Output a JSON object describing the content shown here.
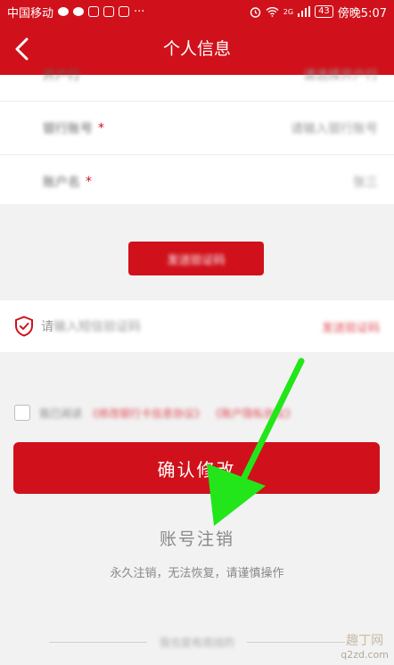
{
  "status_bar": {
    "carrier": "中国移动",
    "more": "···",
    "network": "2G",
    "battery": "43",
    "time": "傍晚5:07"
  },
  "header": {
    "title": "个人信息"
  },
  "form": {
    "partial_label": "开户行",
    "partial_value": "请选择开户行",
    "rows": [
      {
        "label": "银行账号",
        "required": "*",
        "value": "请输入银行账号"
      },
      {
        "label": "账户名",
        "required": "*",
        "value": "张三"
      }
    ]
  },
  "verify_button": {
    "label": "发送验证码"
  },
  "code_row": {
    "prefix": "请",
    "placeholder": "输入短信验证码",
    "send_label": "发送验证码"
  },
  "agreement": {
    "text": "我已阅读",
    "link1": "《修改银行卡信息协议》",
    "link2": "《账户隐私协议》"
  },
  "confirm_button": {
    "label": "确认修改"
  },
  "cancel_account": {
    "label": "账号注销",
    "note": "永久注销，无法恢复，请谨慎操作"
  },
  "bottom_divider": {
    "text": "我也是有底线的"
  },
  "watermark": {
    "line1": "趣丁网",
    "line2": "q2zd.com"
  },
  "colors": {
    "brand_red": "#d0111b",
    "arrow_green": "#22e61a",
    "background": "#f2f2f2"
  },
  "icons": [
    "back-arrow-icon",
    "shield-check-icon",
    "wifi-icon",
    "alarm-icon",
    "wechat-icon",
    "green-arrow-icon"
  ]
}
